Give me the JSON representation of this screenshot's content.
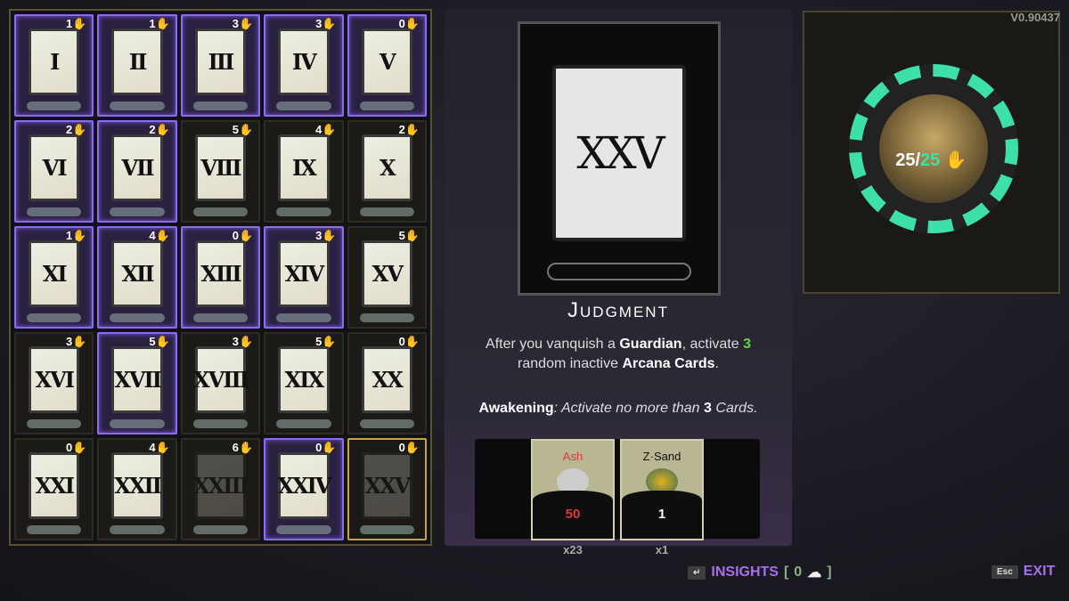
{
  "version": "V0.90437",
  "cards": [
    {
      "numeral": "I",
      "cost": "1",
      "state": "active"
    },
    {
      "numeral": "II",
      "cost": "1",
      "state": "active"
    },
    {
      "numeral": "III",
      "cost": "3",
      "state": "active"
    },
    {
      "numeral": "IV",
      "cost": "3",
      "state": "active"
    },
    {
      "numeral": "V",
      "cost": "0",
      "state": "active"
    },
    {
      "numeral": "VI",
      "cost": "2",
      "state": "active"
    },
    {
      "numeral": "VII",
      "cost": "2",
      "state": "active"
    },
    {
      "numeral": "VIII",
      "cost": "5",
      "state": "inactive"
    },
    {
      "numeral": "IX",
      "cost": "4",
      "state": "inactive"
    },
    {
      "numeral": "X",
      "cost": "2",
      "state": "inactive"
    },
    {
      "numeral": "XI",
      "cost": "1",
      "state": "active"
    },
    {
      "numeral": "XII",
      "cost": "4",
      "state": "active"
    },
    {
      "numeral": "XIII",
      "cost": "0",
      "state": "active"
    },
    {
      "numeral": "XIV",
      "cost": "3",
      "state": "active"
    },
    {
      "numeral": "XV",
      "cost": "5",
      "state": "inactive"
    },
    {
      "numeral": "XVI",
      "cost": "3",
      "state": "inactive"
    },
    {
      "numeral": "XVII",
      "cost": "5",
      "state": "active"
    },
    {
      "numeral": "XVIII",
      "cost": "3",
      "state": "inactive"
    },
    {
      "numeral": "XIX",
      "cost": "5",
      "state": "inactive"
    },
    {
      "numeral": "XX",
      "cost": "0",
      "state": "inactive"
    },
    {
      "numeral": "XXI",
      "cost": "0",
      "state": "inactive"
    },
    {
      "numeral": "XXII",
      "cost": "4",
      "state": "inactive"
    },
    {
      "numeral": "XXIII",
      "cost": "6",
      "state": "locked"
    },
    {
      "numeral": "XXIV",
      "cost": "0",
      "state": "active"
    },
    {
      "numeral": "XXV",
      "cost": "0",
      "state": "selected-locked"
    }
  ],
  "detail": {
    "numeral": "XXV",
    "title": "Judgment",
    "desc_1": "After you vanquish a ",
    "desc_b1": "Guardian",
    "desc_2": ", activate ",
    "desc_n": "3",
    "desc_3": " random inactive ",
    "desc_b2": "Arcana Cards",
    "desc_4": ".",
    "awk_label": "Awakening",
    "awk_1": ": Activate no more than ",
    "awk_n": "3",
    "awk_2": " Cards."
  },
  "resources": [
    {
      "name": "Ash",
      "amount": "50",
      "owned": "x23",
      "color": "#d83a3a"
    },
    {
      "name": "Z·Sand",
      "amount": "1",
      "owned": "x1",
      "color": "#ffffff"
    }
  ],
  "player": {
    "hp": "25",
    "max": "25"
  },
  "footer": {
    "insights_key": "↵",
    "insights": "INSIGHTS",
    "insights_open": "[",
    "insights_count": "0",
    "insights_close": "]",
    "exit_key": "Esc",
    "exit": "EXIT"
  },
  "colors": {
    "accent": "#a870e8",
    "active_border": "#8a6cf0",
    "selected_border": "#c7a24a",
    "grasp": "#3de0a8"
  }
}
